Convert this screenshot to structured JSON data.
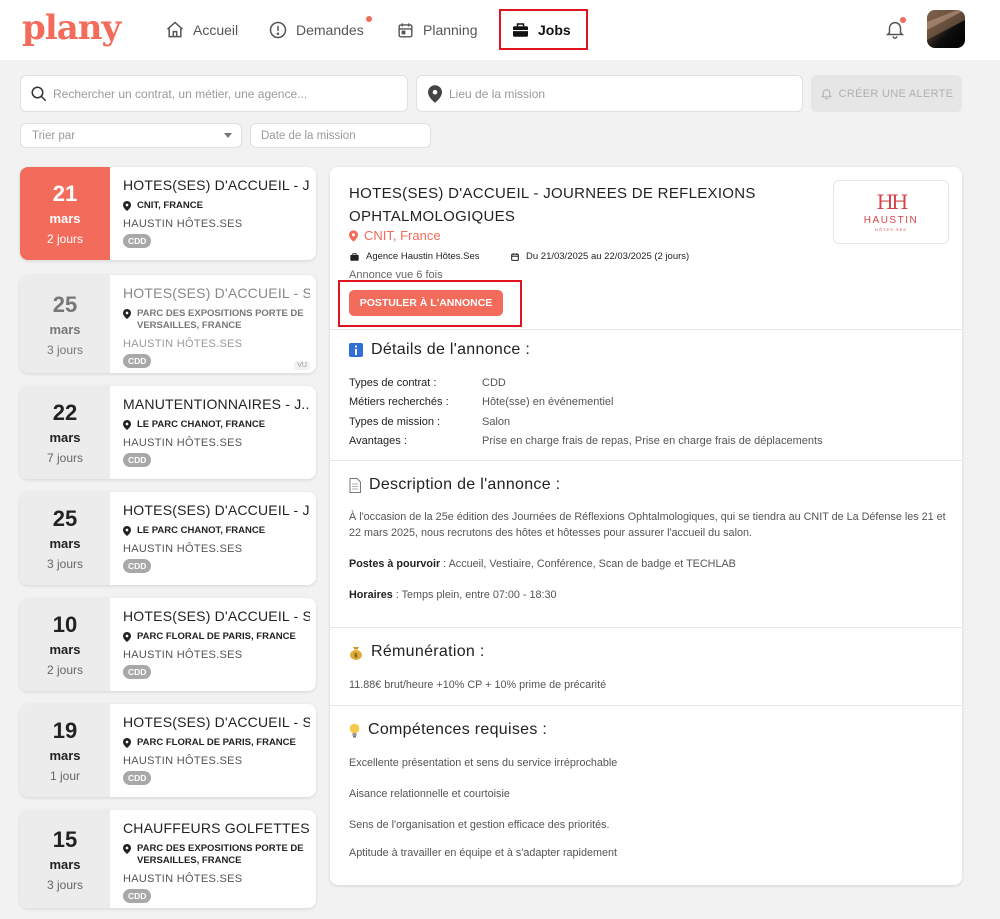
{
  "app": {
    "logo": "plany"
  },
  "nav": {
    "accueil": "Accueil",
    "demandes": "Demandes",
    "planning": "Planning",
    "jobs": "Jobs"
  },
  "search": {
    "query_placeholder": "Rechercher un contrat, un métier, une agence...",
    "location_placeholder": "Lieu de la mission",
    "alert_button": "CRÉER UNE ALERTE",
    "sort_placeholder": "Trier par",
    "date_placeholder": "Date de la mission"
  },
  "jobs": [
    {
      "day": "21",
      "month": "mars",
      "duration": "2 jours",
      "title": "HOTES(SES) D'ACCUEIL - J...",
      "location": "CNIT, FRANCE",
      "agency": "HAUSTIN HÔTES.SES",
      "contract": "CDD"
    },
    {
      "day": "25",
      "month": "mars",
      "duration": "3 jours",
      "title": "HOTES(SES) D'ACCUEIL - S...",
      "location": "PARC DES EXPOSITIONS PORTE DE VERSAILLES, FRANCE",
      "agency": "HAUSTIN HÔTES.SES",
      "contract": "CDD",
      "seen": "VU"
    },
    {
      "day": "22",
      "month": "mars",
      "duration": "7 jours",
      "title": "MANUTENTIONNAIRES - J...",
      "location": "LE PARC CHANOT, FRANCE",
      "agency": "HAUSTIN HÔTES.SES",
      "contract": "CDD"
    },
    {
      "day": "25",
      "month": "mars",
      "duration": "3 jours",
      "title": "HOTES(SES) D'ACCUEIL - J...",
      "location": "LE PARC CHANOT, FRANCE",
      "agency": "HAUSTIN HÔTES.SES",
      "contract": "CDD"
    },
    {
      "day": "10",
      "month": "mars",
      "duration": "2 jours",
      "title": "HOTES(SES) D'ACCUEIL - S...",
      "location": "PARC FLORAL DE PARIS, FRANCE",
      "agency": "HAUSTIN HÔTES.SES",
      "contract": "CDD"
    },
    {
      "day": "19",
      "month": "mars",
      "duration": "1 jour",
      "title": "HOTES(SES) D'ACCUEIL - S...",
      "location": "PARC FLORAL DE PARIS, FRANCE",
      "agency": "HAUSTIN HÔTES.SES",
      "contract": "CDD"
    },
    {
      "day": "15",
      "month": "mars",
      "duration": "3 jours",
      "title": "CHAUFFEURS GOLFETTES...",
      "location": "PARC DES EXPOSITIONS PORTE DE VERSAILLES, FRANCE",
      "agency": "HAUSTIN HÔTES.SES",
      "contract": "CDD"
    }
  ],
  "detail": {
    "title": "HOTES(SES) D'ACCUEIL - JOURNEES DE REFLEXIONS OPHTALMOLOGIQUES",
    "location": "CNIT, France",
    "agency": "Agence Haustin Hôtes.Ses",
    "dates": "Du 21/03/2025 au 22/03/2025 (2 jours)",
    "views": "Annonce vue 6 fois",
    "apply_button": "POSTULER À L'ANNONCE",
    "brand": {
      "monogram": "HH",
      "name": "HAUSTIN",
      "tagline": "HÔTES.SES"
    },
    "details_heading": "Détails de l'annonce :",
    "details": [
      {
        "label": "Types de contrat :",
        "value": "CDD"
      },
      {
        "label": "Métiers recherchés :",
        "value": "Hôte(sse) en événementiel"
      },
      {
        "label": "Types de mission :",
        "value": "Salon"
      },
      {
        "label": "Avantages :",
        "value": "Prise en charge frais de repas, Prise en charge frais de déplacements"
      }
    ],
    "description_heading": "Description de l'annonce :",
    "description": "À l'occasion de la 25e édition des Journées de Réflexions Ophtalmologiques, qui se tiendra au CNIT de La Défense les 21 et 22 mars 2025, nous recrutons des hôtes et hôtesses pour assurer l'accueil du salon.",
    "postes_label": "Postes à pourvoir",
    "postes_value": " : Accueil, Vestiaire, Conférence, Scan de badge et TECHLAB",
    "horaires_label": "Horaires",
    "horaires_value": " : Temps plein, entre 07:00 - 18:30",
    "remuneration_heading": "Rémunération :",
    "remuneration": "11.88€ brut/heure +10% CP + 10% prime de précarité",
    "skills_heading": "Compétences requises :",
    "skills": [
      "Excellente présentation et sens du service irréprochable",
      "Aisance relationnelle et courtoisie",
      "Sens de l'organisation et gestion efficace des priorités.",
      "Aptitude à travailler en équipe et à s'adapter rapidement"
    ]
  },
  "colors": {
    "accent": "#f26b5b",
    "highlight": "#e0141e"
  }
}
